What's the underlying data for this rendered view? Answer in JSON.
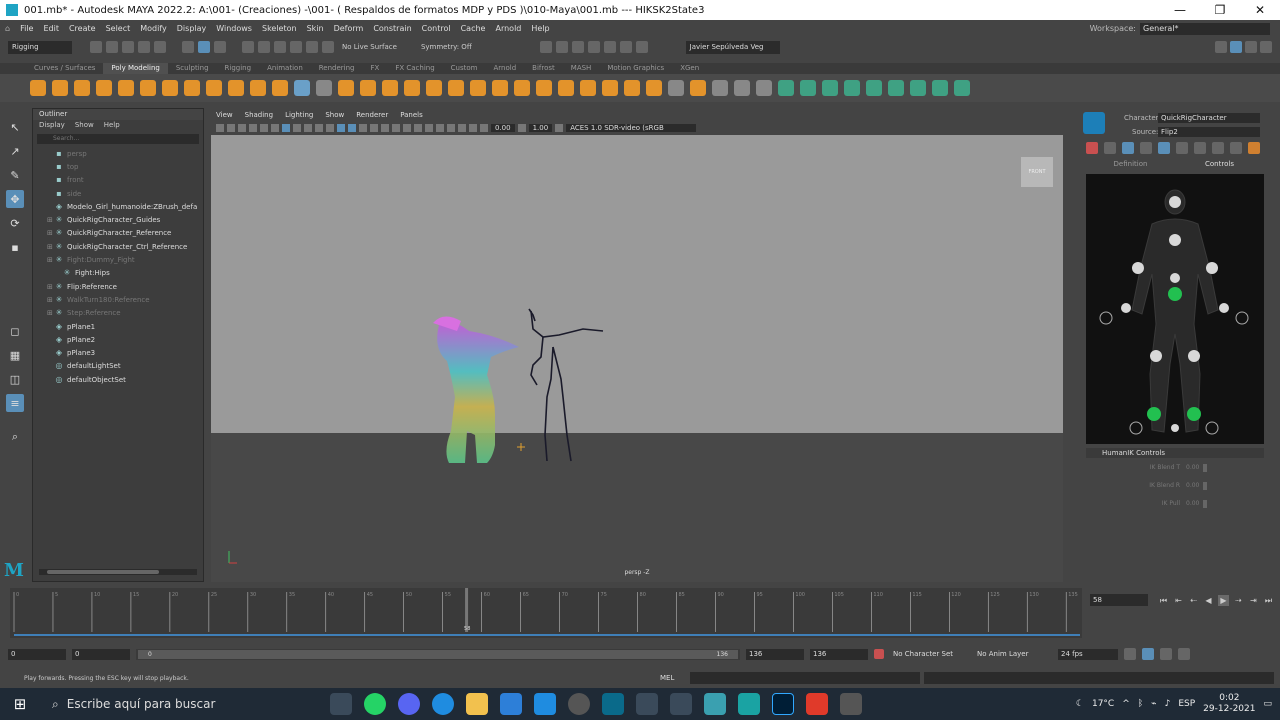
{
  "window": {
    "title": "001.mb* - Autodesk MAYA 2022.2: A:\\001- (Creaciones) -\\001- ( Respaldos de formatos MDP y PDS )\\010-Maya\\001.mb   ---   HIKSK2State3",
    "minimize": "—",
    "maximize": "❐",
    "close": "✕"
  },
  "menubar": {
    "items": [
      "File",
      "Edit",
      "Create",
      "Select",
      "Modify",
      "Display",
      "Windows",
      "Skeleton",
      "Skin",
      "Deform",
      "Constrain",
      "Control",
      "Cache",
      "Arnold",
      "Help"
    ],
    "workspace_label": "Workspace:",
    "workspace_value": "General*"
  },
  "statusline": {
    "mode": "Rigging",
    "live_surface": "No Live Surface",
    "symmetry": "Symmetry: Off",
    "user": "Javier Sepúlveda Veg"
  },
  "shelf": {
    "tabs": [
      "Curves / Surfaces",
      "Poly Modeling",
      "Sculpting",
      "Rigging",
      "Animation",
      "Rendering",
      "FX",
      "FX Caching",
      "Custom",
      "Arnold",
      "Bifrost",
      "MASH",
      "Motion Graphics",
      "XGen"
    ],
    "active_tab": "Poly Modeling"
  },
  "outliner": {
    "title": "Outliner",
    "menu": [
      "Display",
      "Show",
      "Help"
    ],
    "search_placeholder": "Search...",
    "rows": [
      {
        "label": "persp",
        "dim": true,
        "icon": "camera-icon"
      },
      {
        "label": "top",
        "dim": true,
        "icon": "camera-icon"
      },
      {
        "label": "front",
        "dim": true,
        "icon": "camera-icon"
      },
      {
        "label": "side",
        "dim": true,
        "icon": "camera-icon"
      },
      {
        "label": "Modelo_Girl_humanoide:ZBrush_defa",
        "dim": false,
        "icon": "mesh-icon"
      },
      {
        "label": "QuickRigCharacter_Guides",
        "dim": false,
        "icon": "joint-icon"
      },
      {
        "label": "QuickRigCharacter_Reference",
        "dim": false,
        "icon": "joint-icon"
      },
      {
        "label": "QuickRigCharacter_Ctrl_Reference",
        "dim": false,
        "icon": "joint-icon"
      },
      {
        "label": "Fight:Dummy_Fight",
        "dim": true,
        "icon": "joint-icon"
      },
      {
        "label": "Fight:Hips",
        "dim": false,
        "icon": "joint-icon"
      },
      {
        "label": "Flip:Reference",
        "dim": false,
        "icon": "joint-icon"
      },
      {
        "label": "WalkTurn180:Reference",
        "dim": true,
        "icon": "joint-icon"
      },
      {
        "label": "Step:Reference",
        "dim": true,
        "icon": "joint-icon"
      },
      {
        "label": "pPlane1",
        "dim": false,
        "icon": "mesh-icon"
      },
      {
        "label": "pPlane2",
        "dim": false,
        "icon": "mesh-icon"
      },
      {
        "label": "pPlane3",
        "dim": false,
        "icon": "mesh-icon"
      },
      {
        "label": "defaultLightSet",
        "dim": false,
        "icon": "set-icon"
      },
      {
        "label": "defaultObjectSet",
        "dim": false,
        "icon": "set-icon"
      }
    ]
  },
  "viewport": {
    "menu": [
      "View",
      "Shading",
      "Lighting",
      "Show",
      "Renderer",
      "Panels"
    ],
    "exposure": "0.00",
    "gamma": "1.00",
    "color_space": "ACES 1.0 SDR-video (sRGB",
    "camera_label": "persp -Z",
    "front_label": "FRONT"
  },
  "hik": {
    "character_label": "Character:",
    "character_value": "QuickRigCharacter",
    "source_label": "Source:",
    "source_value": "Flip2",
    "tabs": [
      "Definition",
      "Controls"
    ],
    "active_tab": "Controls",
    "controls_header": "HumanIK Controls",
    "ik_rows": [
      {
        "label": "IK Blend T",
        "value": "0.00"
      },
      {
        "label": "IK Blend R",
        "value": "0.00"
      },
      {
        "label": "IK Pull",
        "value": "0.00"
      }
    ]
  },
  "timeline": {
    "current_frame": "58",
    "ticks": [
      "0",
      "5",
      "10",
      "15",
      "20",
      "25",
      "30",
      "35",
      "40",
      "45",
      "50",
      "55",
      "60",
      "65",
      "70",
      "75",
      "80",
      "85",
      "90",
      "95",
      "100",
      "105",
      "110",
      "115",
      "120",
      "125",
      "130",
      "135"
    ],
    "playhead_label": "58",
    "playhead_frame": 58
  },
  "range": {
    "start": "0",
    "inner_start": "0",
    "inner_start_label": "0",
    "inner_end_label": "136",
    "end_a": "136",
    "end_b": "136",
    "character_set": "No Character Set",
    "anim_layer": "No Anim Layer",
    "fps": "24 fps"
  },
  "cmdline": {
    "help": "Play forwards. Pressing the ESC key will stop playback.",
    "mel": "MEL"
  },
  "taskbar": {
    "search": "Escribe aquí para buscar",
    "temp": "17°C",
    "lang": "ESP",
    "time": "0:02",
    "date": "29-12-2021"
  }
}
